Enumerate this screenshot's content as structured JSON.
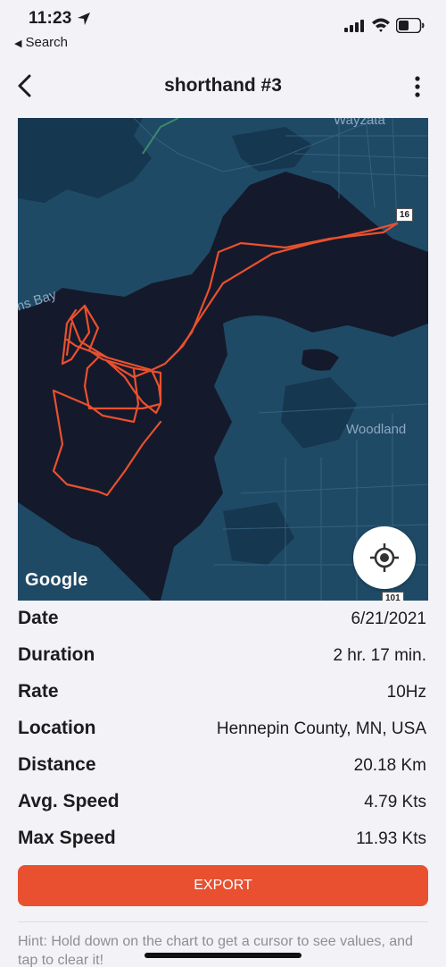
{
  "status_bar": {
    "time": "11:23",
    "back_app": "Search"
  },
  "nav": {
    "title": "shorthand #3"
  },
  "map": {
    "labels": {
      "wayzata": "Wayzata",
      "woodland": "Woodland",
      "bay": "ns Bay",
      "route_16": "16",
      "route_101": "101"
    },
    "google": "Google",
    "track_color": "#e9502f",
    "water_color": "#141a2b",
    "land_color": "#1f4a66"
  },
  "details": [
    {
      "label": "Date",
      "value": "6/21/2021"
    },
    {
      "label": "Duration",
      "value": "2 hr. 17 min."
    },
    {
      "label": "Rate",
      "value": "10Hz"
    },
    {
      "label": "Location",
      "value": "Hennepin County, MN, USA"
    },
    {
      "label": "Distance",
      "value": "20.18 Km"
    },
    {
      "label": "Avg. Speed",
      "value": "4.79 Kts"
    },
    {
      "label": "Max Speed",
      "value": "11.93 Kts"
    }
  ],
  "export_label": "EXPORT",
  "hint": "Hint: Hold down on the chart to get a cursor to see values, and tap to clear it!",
  "colors": {
    "accent": "#e9502f",
    "background": "#f2f2f7"
  }
}
